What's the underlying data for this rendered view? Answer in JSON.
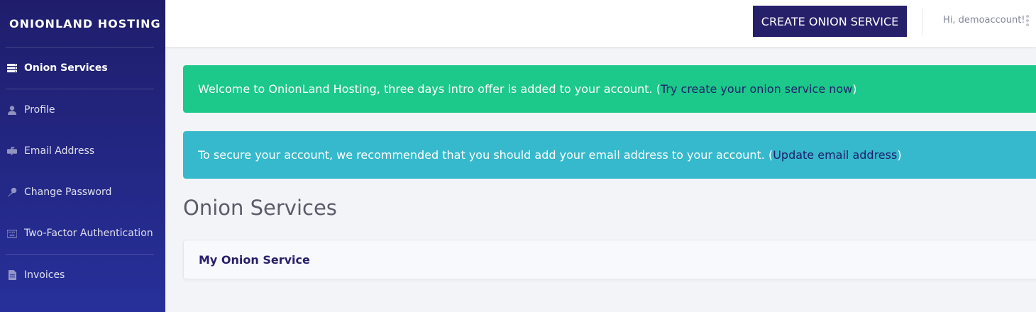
{
  "brand": {
    "name": "ONIONLAND HOSTING"
  },
  "sidebar": {
    "items": [
      {
        "label": "Onion Services",
        "icon": "server-icon",
        "active": true
      },
      {
        "label": "Profile",
        "icon": "user-icon",
        "active": false
      },
      {
        "label": "Email Address",
        "icon": "mailbox-icon",
        "active": false
      },
      {
        "label": "Change Password",
        "icon": "key-icon",
        "active": false
      },
      {
        "label": "Two-Factor Authentication",
        "icon": "keyboard-icon",
        "active": false
      },
      {
        "label": "Invoices",
        "icon": "file-invoice-icon",
        "active": false
      }
    ]
  },
  "topbar": {
    "create_button": "CREATE ONION SERVICE",
    "greeting": "Hi, demoaccount!"
  },
  "alerts": {
    "welcome": {
      "text": "Welcome to OnionLand Hosting, three days intro offer is added to your account. (",
      "link": "Try create your onion service now",
      "suffix": ")"
    },
    "security": {
      "text": "To secure your account, we recommended that you should add your email address to your account. (",
      "link": "Update email address",
      "suffix": ")"
    }
  },
  "main": {
    "title": "Onion Services",
    "card_title": "My Onion Service"
  },
  "colors": {
    "sidebar_top": "#1f1d6b",
    "sidebar_bottom": "#27309a",
    "primary_button": "#26206b",
    "success": "#1cc88a",
    "info": "#36b9cc"
  }
}
